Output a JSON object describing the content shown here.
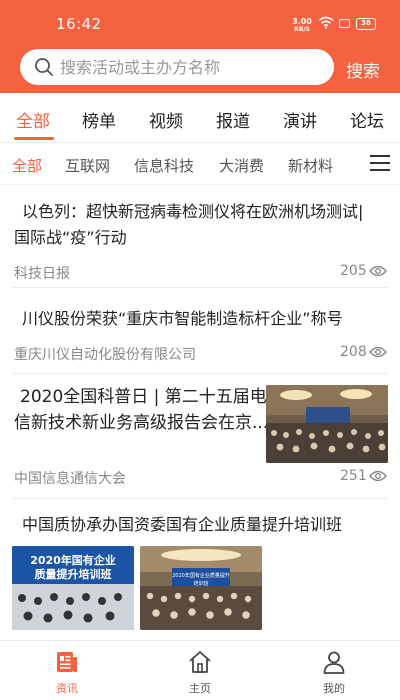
{
  "status_bar": {
    "time": "16:42",
    "net_speed": "3.00",
    "net_unit": "KB/S",
    "battery": "38"
  },
  "search": {
    "placeholder": "搜索活动或主办方名称",
    "value": "",
    "button_label": "搜索"
  },
  "main_tabs": [
    {
      "label": "全部",
      "active": true
    },
    {
      "label": "榜单",
      "active": false
    },
    {
      "label": "视频",
      "active": false
    },
    {
      "label": "报道",
      "active": false
    },
    {
      "label": "演讲",
      "active": false
    },
    {
      "label": "论坛",
      "active": false
    }
  ],
  "categories": [
    {
      "label": "全部",
      "active": true
    },
    {
      "label": "互联网",
      "active": false
    },
    {
      "label": "信息科技",
      "active": false
    },
    {
      "label": "大消费",
      "active": false
    },
    {
      "label": "新材料",
      "active": false
    }
  ],
  "feed": [
    {
      "title_line1": "以色列：超快新冠病毒检测仪将在欧洲机场测试|",
      "title_line2": "国际战“疫”行动",
      "source": "科技日报",
      "views": "205"
    },
    {
      "title_line1": "川仪股份荣获“重庆市智能制造标杆企业”称号",
      "source": "重庆川仪自动化股份有限公司",
      "views": "208"
    },
    {
      "title_line1": "2020全国科普日 | 第二十五届电",
      "title_line2": "信新技术新业务高级报告会在京...",
      "source": "中国信息通信大会",
      "views": "251",
      "thumbnail": "conference-hall-photo"
    },
    {
      "title_line1": "中国质协承办国资委国有企业质量提升培训班",
      "images": [
        {
          "caption_line1": "2020年国有企业",
          "caption_line2": "质量提升培训班"
        },
        {
          "caption_line1": "2020年国有企业质量提升培训班"
        }
      ]
    }
  ],
  "bottom_nav": [
    {
      "label": "资讯",
      "icon": "news-icon",
      "active": true
    },
    {
      "label": "主页",
      "icon": "home-icon",
      "active": false
    },
    {
      "label": "我的",
      "icon": "user-icon",
      "active": false
    }
  ],
  "colors": {
    "accent": "#f5623f",
    "text": "#222222",
    "muted": "#888888"
  }
}
